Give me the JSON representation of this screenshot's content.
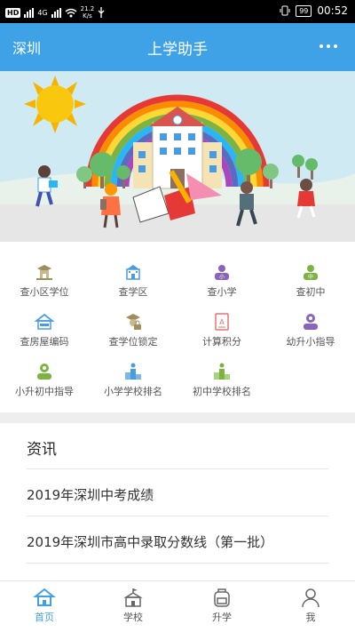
{
  "status_bar": {
    "network_type": "HD",
    "signal_label": "4G",
    "net_speed_value": "21.2",
    "net_speed_unit": "K/s",
    "battery": "99",
    "time": "00:52"
  },
  "header": {
    "city": "深圳",
    "title": "上学助手"
  },
  "menu": {
    "rows": [
      [
        {
          "label": "查小区学位",
          "icon": "house-graduation-icon",
          "color": "#a08d5c"
        },
        {
          "label": "查学区",
          "icon": "school-building-icon",
          "color": "#4a9ce0"
        },
        {
          "label": "查小学",
          "icon": "primary-school-icon",
          "color": "#8a64b8"
        },
        {
          "label": "查初中",
          "icon": "middle-school-icon",
          "color": "#7cb342"
        }
      ],
      [
        {
          "label": "查房屋编码",
          "icon": "house-code-icon",
          "color": "#4a9ce0"
        },
        {
          "label": "查学位锁定",
          "icon": "degree-lock-icon",
          "color": "#a08d5c"
        },
        {
          "label": "计算积分",
          "icon": "calculator-document-icon",
          "color": "#e57373"
        },
        {
          "label": "幼升小指导",
          "icon": "kindergarten-guide-icon",
          "color": "#8a64b8"
        }
      ],
      [
        {
          "label": "小升初中指导",
          "icon": "middle-school-guide-icon",
          "color": "#7cb342"
        },
        {
          "label": "小学学校排名",
          "icon": "primary-ranking-podium-icon",
          "color": "#4a9ce0"
        },
        {
          "label": "初中学校排名",
          "icon": "middle-ranking-podium-icon",
          "color": "#7cb342"
        }
      ]
    ]
  },
  "news": {
    "title": "资讯",
    "items": [
      {
        "title": "2019年深圳中考成绩"
      },
      {
        "title": "2019年深圳市高中录取分数线（第一批）"
      }
    ]
  },
  "tabbar": {
    "items": [
      {
        "label": "首页",
        "icon": "home-icon",
        "active": true
      },
      {
        "label": "学校",
        "icon": "school-icon",
        "active": false
      },
      {
        "label": "升学",
        "icon": "backpack-icon",
        "active": false
      },
      {
        "label": "我",
        "icon": "user-icon",
        "active": false
      }
    ]
  },
  "colors": {
    "accent": "#3fa2e6",
    "status_bar": "#000000"
  }
}
